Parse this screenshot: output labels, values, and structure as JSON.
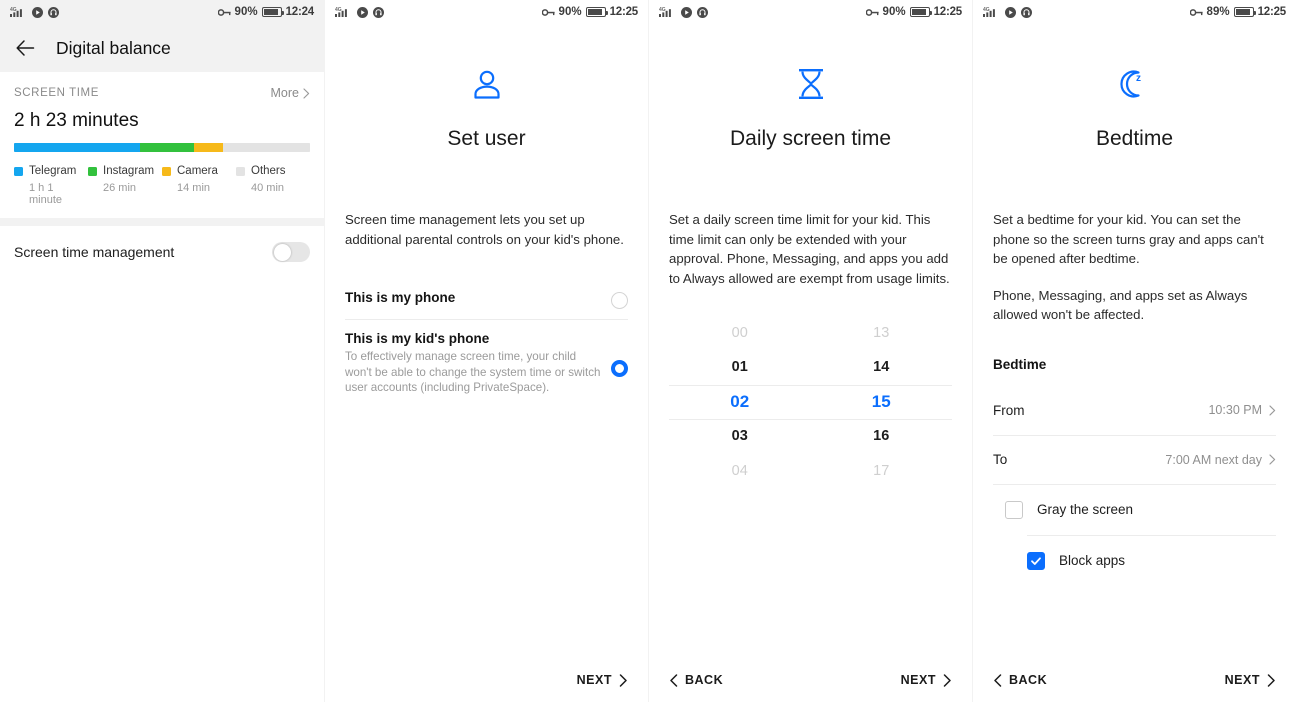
{
  "accent": "#0b6efd",
  "panels": [
    {
      "id": "digital-balance",
      "status": {
        "network": "4G",
        "battery_pct": "90%",
        "time": "12:24"
      },
      "appbar": {
        "title": "Digital balance"
      },
      "screen_time": {
        "section_label": "SCREEN TIME",
        "more_label": "More",
        "total": "2 h 23 minutes",
        "apps": [
          {
            "name": "Telegram",
            "value": "1 h 1 minute",
            "color": "#14a6ef",
            "pct": 42.6
          },
          {
            "name": "Instagram",
            "value": "26 min",
            "color": "#32c13d",
            "pct": 18.2
          },
          {
            "name": "Camera",
            "value": "14 min",
            "color": "#f6b91a",
            "pct": 9.8
          },
          {
            "name": "Others",
            "value": "40 min",
            "color": "#e3e3e3",
            "pct": 29.4
          }
        ]
      },
      "toggle_row": {
        "label": "Screen time management",
        "state": "off"
      }
    },
    {
      "id": "set-user",
      "status": {
        "network": "4G",
        "battery_pct": "90%",
        "time": "12:25"
      },
      "icon": "person-icon",
      "title": "Set user",
      "paragraphs": [
        "Screen time management lets you set up additional parental controls on your kid's phone."
      ],
      "options": [
        {
          "title": "This is my phone",
          "subtitle": "",
          "selected": false
        },
        {
          "title": "This is my kid's phone",
          "subtitle": "To effectively manage screen time, your child won't be able to change the system time or switch user accounts (including PrivateSpace).",
          "selected": true
        }
      ],
      "footer": {
        "next_label": "NEXT"
      }
    },
    {
      "id": "daily-screen-time",
      "status": {
        "network": "4G",
        "battery_pct": "90%",
        "time": "12:25"
      },
      "icon": "hourglass-icon",
      "title": "Daily screen time",
      "paragraphs": [
        "Set a daily screen time limit for your kid. This time limit can only be extended with your approval. Phone, Messaging, and apps you add to Always allowed are exempt from usage limits."
      ],
      "picker": {
        "hours": {
          "values": [
            "00",
            "01",
            "02",
            "03",
            "04"
          ],
          "selected_index": 2,
          "selected": "02"
        },
        "minutes": {
          "values": [
            "13",
            "14",
            "15",
            "16",
            "17"
          ],
          "selected_index": 2,
          "selected": "15"
        }
      },
      "footer": {
        "back_label": "BACK",
        "next_label": "NEXT"
      }
    },
    {
      "id": "bedtime",
      "status": {
        "network": "4G",
        "battery_pct": "89%",
        "time": "12:25"
      },
      "icon": "moon-zzz-icon",
      "title": "Bedtime",
      "paragraphs": [
        "Set a bedtime for your kid. You can set the phone so the screen turns gray and apps can't be opened after bedtime.",
        "Phone, Messaging, and apps set as Always allowed won't be affected."
      ],
      "bedtime_heading": "Bedtime",
      "rows": [
        {
          "label": "From",
          "value": "10:30 PM"
        },
        {
          "label": "To",
          "value": "7:00 AM next day"
        }
      ],
      "checkboxes": [
        {
          "label": "Gray the screen",
          "checked": false
        },
        {
          "label": "Block apps",
          "checked": true
        }
      ],
      "footer": {
        "back_label": "BACK",
        "next_label": "NEXT"
      }
    }
  ]
}
